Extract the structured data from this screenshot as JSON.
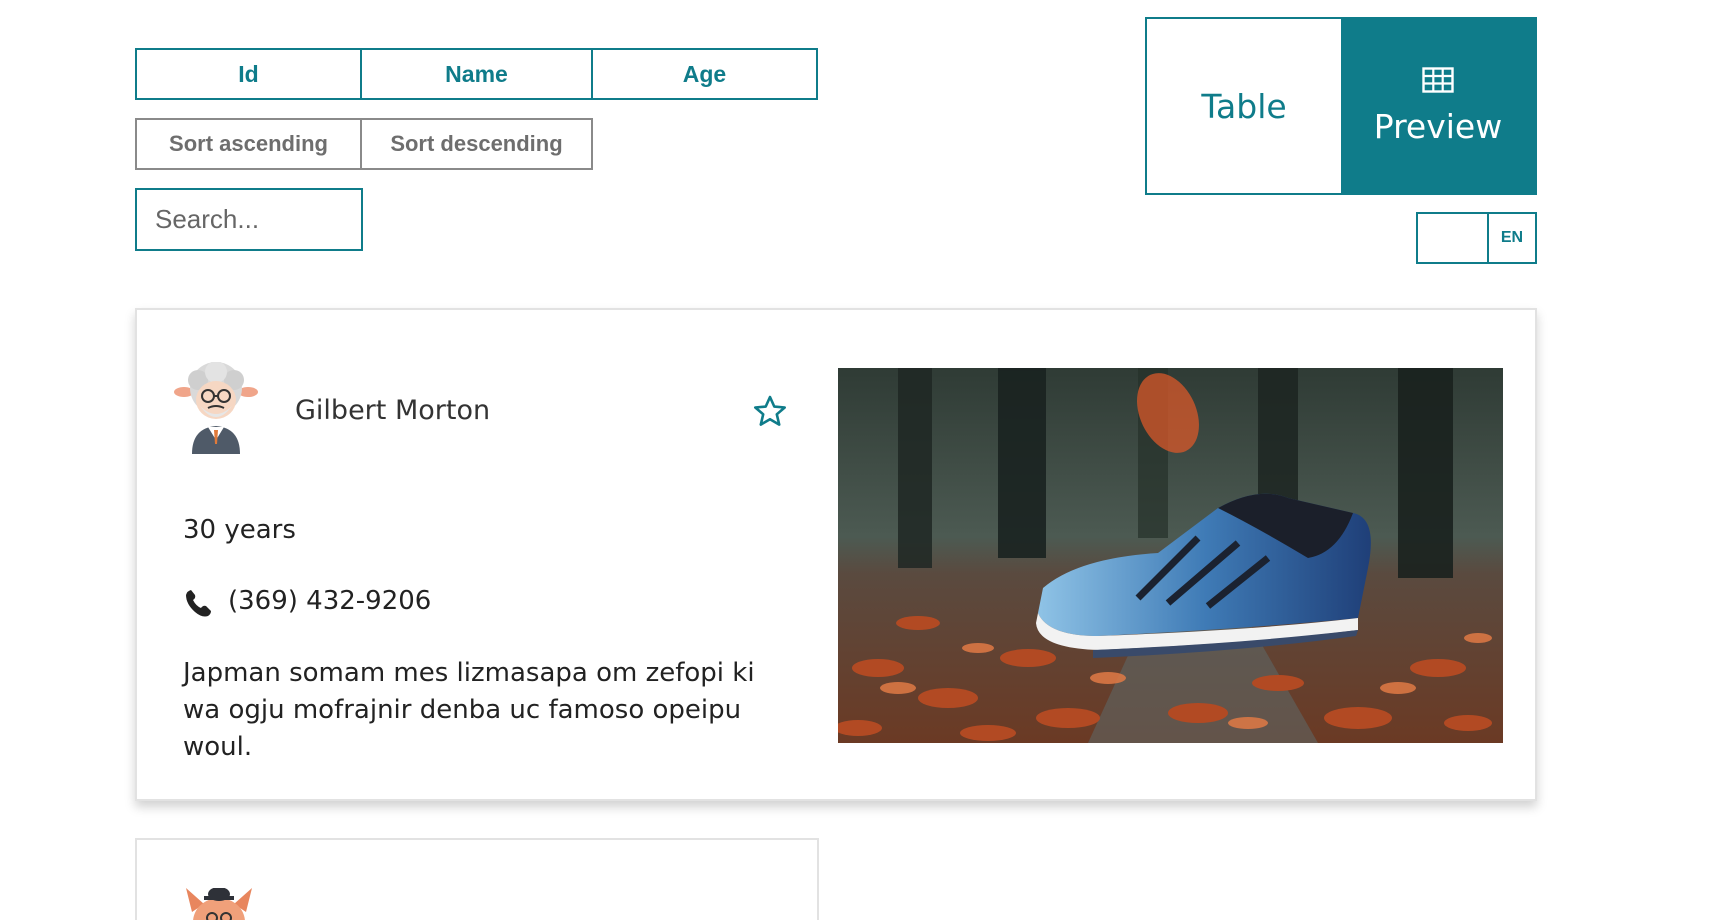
{
  "sort_fields": [
    "Id",
    "Name",
    "Age"
  ],
  "sort_orders": [
    "Sort ascending",
    "Sort descending"
  ],
  "search": {
    "placeholder": "Search..."
  },
  "view_toggle": {
    "table_label": "Table",
    "preview_label": "Preview",
    "active": "Preview",
    "preview_icon": "table-grid-icon"
  },
  "language": {
    "current": "EN"
  },
  "colors": {
    "accent": "#0f7c8a",
    "muted_border": "#8a8a8a",
    "card_border": "#e2e2e2"
  },
  "cards": [
    {
      "name": "Gilbert Morton",
      "age_text": "30 years",
      "phone": "(369) 432-9206",
      "description": "Japman somam mes lizmasapa om zefopi ki wa ogju mofrajnir denba uc famoso opeipu woul.",
      "favorite": false,
      "avatar": "old-man-avatar-icon",
      "image": "running-shoe-on-autumn-leaves"
    },
    {
      "avatar": "fox-avatar-icon"
    }
  ]
}
